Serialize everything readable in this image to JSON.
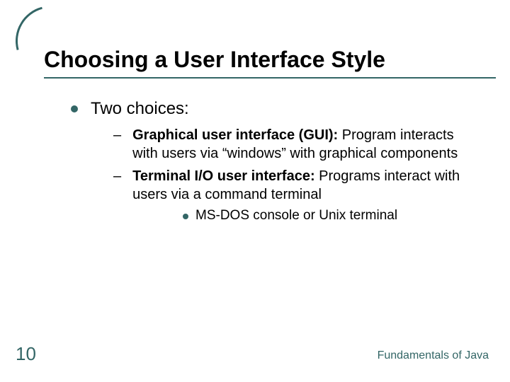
{
  "title": "Choosing a User Interface Style",
  "l1_text": "Two choices:",
  "sub": [
    {
      "bold": "Graphical user interface (GUI):",
      "rest": " Program interacts with users via “windows” with graphical components"
    },
    {
      "bold": "Terminal I/O user interface:",
      "rest": " Programs interact with users via a command terminal"
    }
  ],
  "l3_text": "MS-DOS console or Unix terminal",
  "slide_number": "10",
  "footer": "Fundamentals of Java"
}
